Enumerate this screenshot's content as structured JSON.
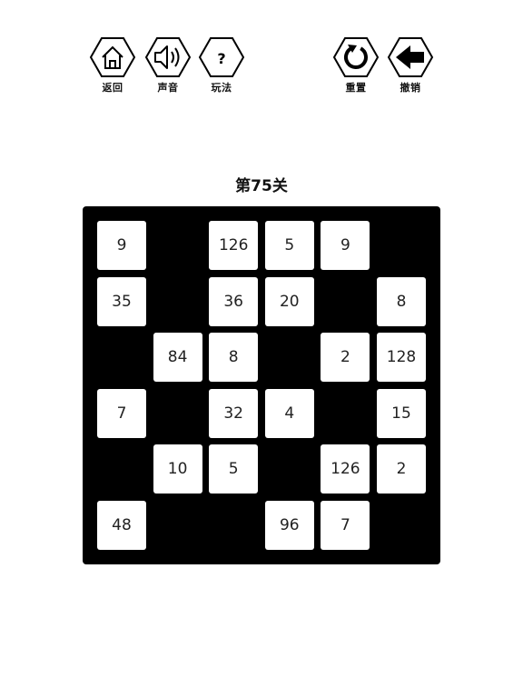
{
  "toolbar": {
    "back_label": "返回",
    "sound_label": "声音",
    "help_label": "玩法",
    "help_glyph": "?",
    "reset_label": "重置",
    "undo_label": "撤销"
  },
  "level": {
    "title": "第75关"
  },
  "board": {
    "rows": 6,
    "cols": 6,
    "cells": [
      [
        "9",
        "",
        "126",
        "5",
        "9",
        ""
      ],
      [
        "35",
        "",
        "36",
        "20",
        "",
        "8"
      ],
      [
        "",
        "84",
        "8",
        "",
        "2",
        "128"
      ],
      [
        "7",
        "",
        "32",
        "4",
        "",
        "15"
      ],
      [
        "",
        "10",
        "5",
        "",
        "126",
        "2"
      ],
      [
        "48",
        "",
        "",
        "96",
        "7",
        ""
      ]
    ]
  },
  "colors": {
    "board": "#000000",
    "tile": "#ffffff",
    "background": "#ffffff"
  }
}
